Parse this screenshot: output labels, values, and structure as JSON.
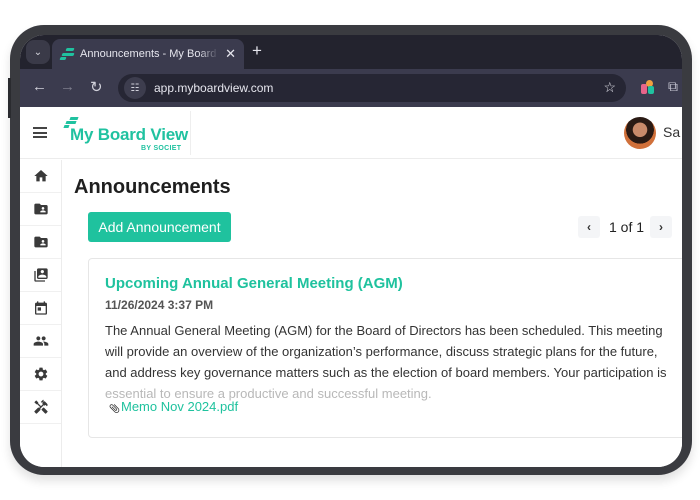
{
  "browser": {
    "tab_title": "Announcements - My Board View",
    "tab_close": "✕",
    "new_tab": "+",
    "tab_menu": "⌄",
    "url": "app.myboardview.com",
    "icons": {
      "back": "←",
      "forward": "→",
      "reload": "↻",
      "site_info": "☷",
      "bookmark": "☆",
      "extensions": "⧉"
    }
  },
  "app": {
    "logo": {
      "title": "My Board View",
      "subtitle": "BY SOCIET"
    },
    "user": {
      "name": "Sa"
    },
    "sidebar": {
      "items": [
        {
          "icon": "home-icon"
        },
        {
          "icon": "folder-account-icon"
        },
        {
          "icon": "folder-account-icon"
        },
        {
          "icon": "contacts-library-icon"
        },
        {
          "icon": "calendar-icon"
        },
        {
          "icon": "people-icon"
        },
        {
          "icon": "gear-icon"
        },
        {
          "icon": "tools-icon"
        }
      ]
    },
    "main": {
      "title": "Announcements",
      "add_button": "Add Announcement",
      "pager": {
        "prev": "‹",
        "text": "1 of 1",
        "next": "›"
      },
      "announcement": {
        "title": "Upcoming Annual General Meeting (AGM)",
        "date": "11/26/2024 3:37 PM",
        "body_lines": [
          "The Annual General Meeting (AGM) for the Board of Directors has been scheduled. This meeting",
          "will provide an overview of the organization’s performance, discuss strategic plans for the future,",
          "and address key governance matters such as the election of board members. Your participation is",
          "essential to ensure a productive and successful meeting."
        ],
        "attachment": "Memo Nov 2024.pdf",
        "paperclip": "⊂"
      }
    }
  },
  "colors": {
    "brand": "#1fc29e",
    "browser_dark": "#23232e",
    "browser_toolbar": "#3b3b4e"
  }
}
